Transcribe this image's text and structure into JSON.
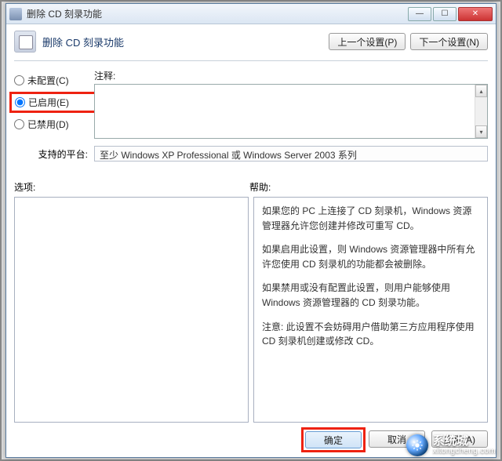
{
  "window": {
    "title": "删除 CD 刻录功能"
  },
  "header": {
    "title": "删除 CD 刻录功能",
    "prev": "上一个设置(P)",
    "next": "下一个设置(N)"
  },
  "radios": {
    "not_configured": "未配置(C)",
    "enabled": "已启用(E)",
    "disabled": "已禁用(D)"
  },
  "comment": {
    "label": "注释:",
    "value": ""
  },
  "platform": {
    "label": "支持的平台:",
    "value": "至少 Windows XP Professional 或 Windows Server 2003 系列"
  },
  "sections": {
    "options": "选项:",
    "help": "帮助:"
  },
  "help": {
    "p1": "如果您的 PC 上连接了 CD 刻录机，Windows 资源管理器允许您创建并修改可重写 CD。",
    "p2": "如果启用此设置，则 Windows 资源管理器中所有允许您使用 CD 刻录机的功能都会被删除。",
    "p3": "如果禁用或没有配置此设置，则用户能够使用 Windows 资源管理器的 CD 刻录功能。",
    "p4": "注意: 此设置不会妨碍用户借助第三方应用程序使用 CD 刻录机创建或修改 CD。"
  },
  "footer": {
    "ok": "确定",
    "cancel": "取消",
    "apply": "应用(A)"
  },
  "watermark": {
    "cn": "系统城",
    "url": "xitongcheng.com"
  }
}
